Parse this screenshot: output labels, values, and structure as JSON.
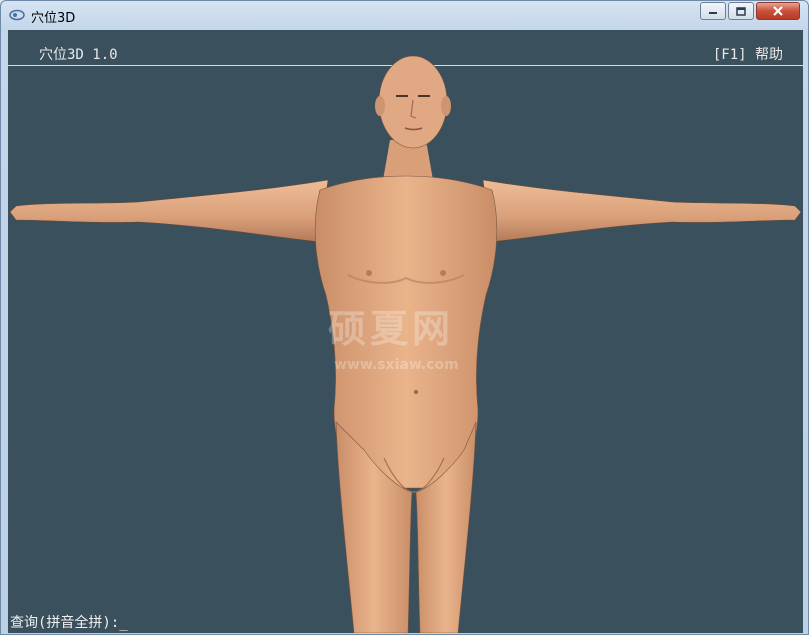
{
  "window": {
    "title": "穴位3D"
  },
  "app": {
    "header_left": "穴位3D 1.0",
    "header_right": "[F1] 帮助"
  },
  "watermark": {
    "main": "硕夏网",
    "sub": "www.sxiaw.com"
  },
  "query": {
    "label": "查询(拼音全拼):",
    "cursor": "_"
  },
  "colors": {
    "viewport_bg": "#3a505c",
    "skin": "#e2aa80",
    "header_text": "#e8e8e8"
  },
  "icons": {
    "app": "app-icon",
    "minimize": "minimize-icon",
    "maximize": "maximize-icon",
    "close": "close-icon"
  }
}
